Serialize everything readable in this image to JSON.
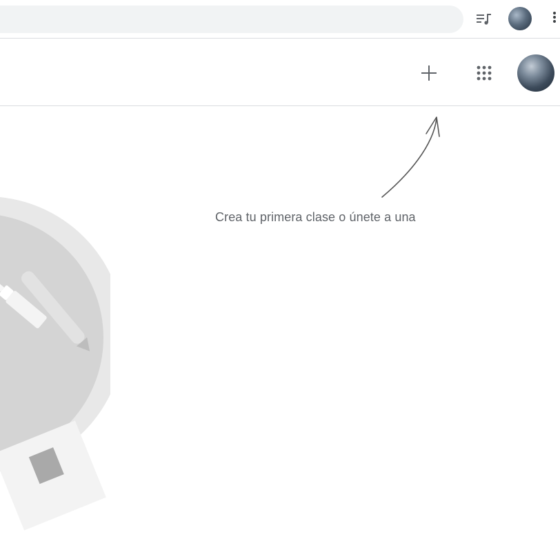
{
  "browser": {
    "icons": {
      "media": "media-control-icon",
      "profile": "profile-avatar",
      "menu": "more-vert-icon"
    }
  },
  "header": {
    "icons": {
      "create": "plus-icon",
      "apps": "apps-grid-icon",
      "account": "account-avatar"
    }
  },
  "empty_state": {
    "hint": "Crea tu primera clase o únete a una"
  },
  "colors": {
    "hint_text": "#5f6368",
    "divider": "#dadce0",
    "omnibox_bg": "#f1f3f4",
    "illustration_light": "#e8e8e8",
    "illustration_circle": "#d4d4d4",
    "illustration_dark": "#a9a9a9"
  }
}
